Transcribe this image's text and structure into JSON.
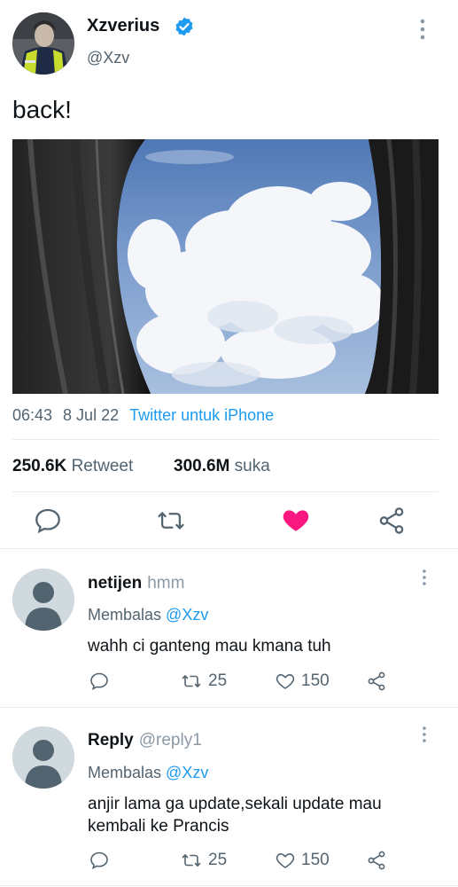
{
  "tweet": {
    "display_name": "Xzverius",
    "handle": "@Xzv",
    "text": "back!",
    "time": "06:43",
    "date": "8 Jul 22",
    "source": "Twitter untuk iPhone",
    "retweets_count": "250.6K",
    "retweets_label": "Retweet",
    "likes_count": "300.6M",
    "likes_label": "suka",
    "liked": true
  },
  "replies": [
    {
      "name": "netijen",
      "handle": "hmm",
      "reply_prefix": "Membalas",
      "reply_to": "@Xzv",
      "text": "wahh ci ganteng mau kmana tuh",
      "retweets": "25",
      "likes": "150"
    },
    {
      "name": "Reply",
      "handle": "@reply1",
      "reply_prefix": "Membalas",
      "reply_to": "@Xzv",
      "text": "anjir lama ga update,sekali update mau kembali ke Prancis",
      "retweets": "25",
      "likes": "150"
    }
  ],
  "colors": {
    "accent": "#1d9bf0",
    "like": "#f91880",
    "muted": "#536471"
  },
  "icons": [
    "verified-badge-icon",
    "more-icon",
    "reply-icon",
    "retweet-icon",
    "heart-icon",
    "share-icon",
    "default-avatar-icon"
  ]
}
